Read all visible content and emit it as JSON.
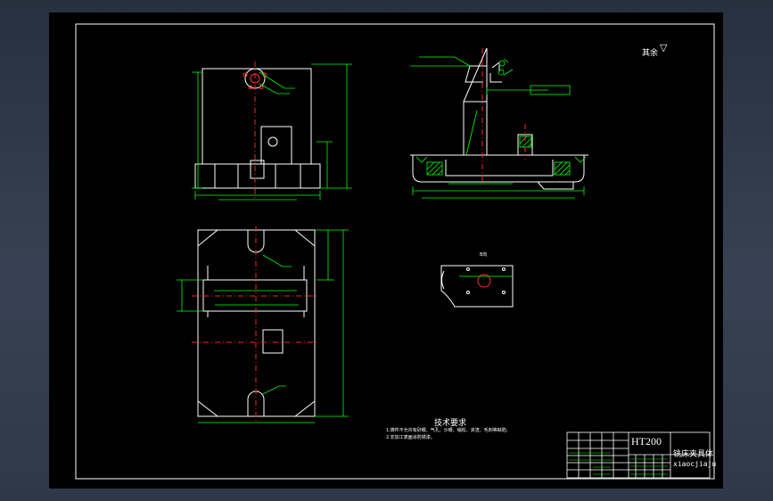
{
  "drawing": {
    "title_block": {
      "material": "HT200",
      "part_name": "铣床夹具体",
      "part_pinyin": "xiaocjiaju"
    },
    "roughness_note": "其余",
    "tech_requirements": {
      "heading": "技术要求",
      "items": [
        "1.铸件不允许有砂眼、气孔、沙眼、缩松、夹渣、毛刺等缺陷;",
        "2.非加工表面涂防锈漆。"
      ]
    },
    "aux_view_label": "B向",
    "colors": {
      "outline": "#ffffff",
      "dimension": "#00ff00",
      "centerline": "#ff2020",
      "hatch": "#00ff00",
      "leader": "#ff0000",
      "sheet": "#000000"
    }
  }
}
